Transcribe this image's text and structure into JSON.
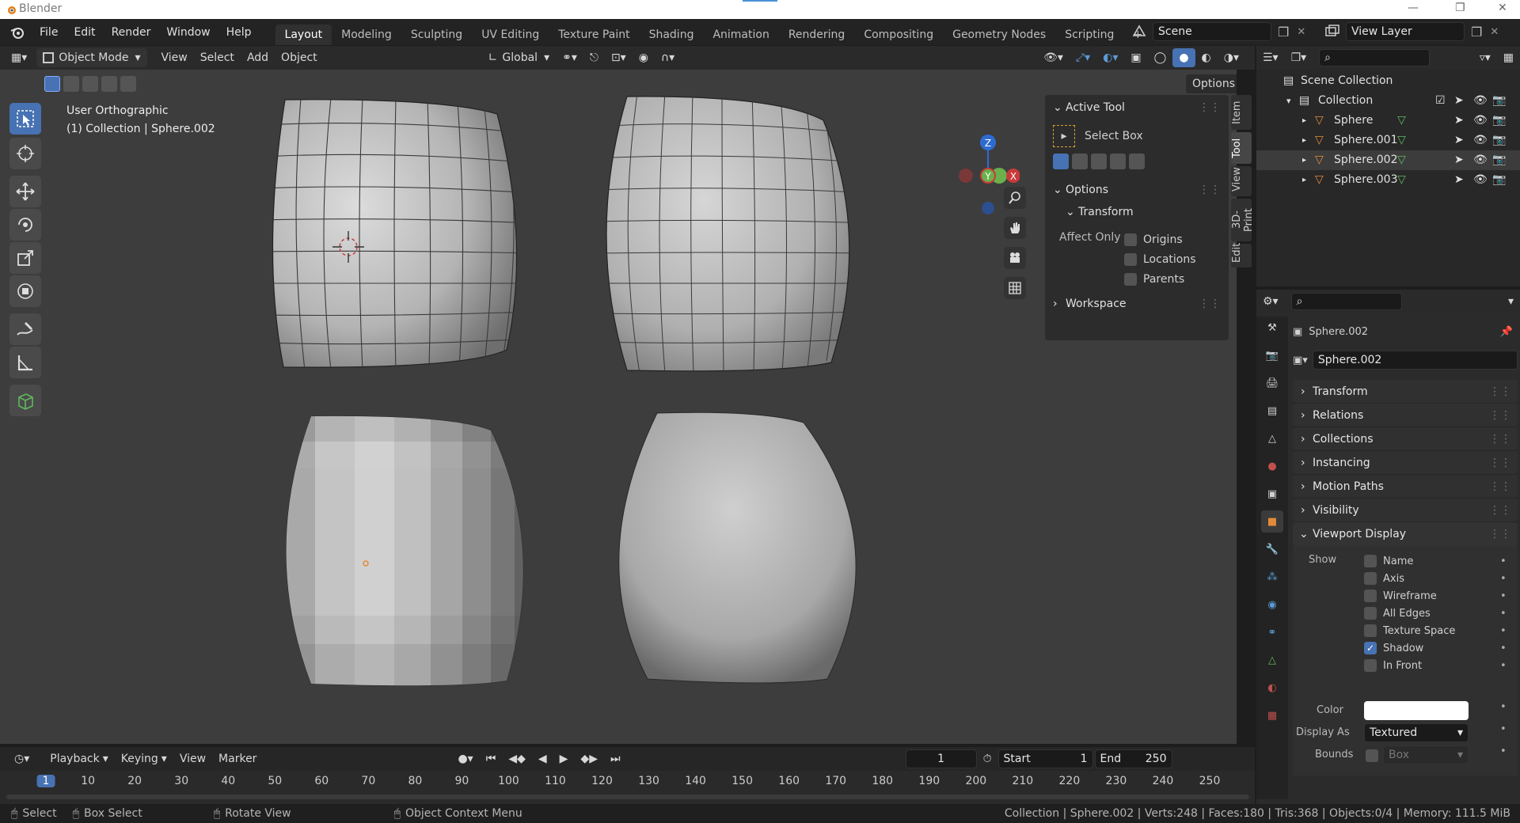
{
  "window": {
    "title": "Blender"
  },
  "menu": [
    "File",
    "Edit",
    "Render",
    "Window",
    "Help"
  ],
  "workspaces": [
    "Layout",
    "Modeling",
    "Sculpting",
    "UV Editing",
    "Texture Paint",
    "Shading",
    "Animation",
    "Rendering",
    "Compositing",
    "Geometry Nodes",
    "Scripting",
    "+"
  ],
  "active_workspace": "Layout",
  "scene": {
    "name": "Scene",
    "view_layer": "View Layer"
  },
  "viewport_header": {
    "mode": "Object Mode",
    "menus": [
      "View",
      "Select",
      "Add",
      "Object"
    ],
    "transform_orientation": "Global",
    "options_label": "Options"
  },
  "viewport_overlay": {
    "view_name": "User Orthographic",
    "collection_info": "(1) Collection | Sphere.002"
  },
  "gizmo": {
    "z": "Z",
    "y": "Y",
    "x": "X"
  },
  "npanel": {
    "active_tool_header": "Active Tool",
    "tool_name": "Select Box",
    "options_header": "Options",
    "transform_header": "Transform",
    "affect_only_label": "Affect Only",
    "affect_options": [
      "Origins",
      "Locations",
      "Parents"
    ],
    "workspace_header": "Workspace",
    "tabs": [
      "Item",
      "Tool",
      "View",
      "3D-Print",
      "Edit"
    ],
    "active_tab": "Tool"
  },
  "outliner": {
    "root": "Scene Collection",
    "collection": "Collection",
    "objects": [
      "Sphere",
      "Sphere.001",
      "Sphere.002",
      "Sphere.003"
    ],
    "selected_object": "Sphere.002"
  },
  "properties": {
    "object_name": "Sphere.002",
    "object_field": "Sphere.002",
    "sections_collapsed": [
      "Transform",
      "Relations",
      "Collections",
      "Instancing",
      "Motion Paths",
      "Visibility"
    ],
    "viewport_display": {
      "header": "Viewport Display",
      "show_label": "Show",
      "show_options": [
        {
          "label": "Name",
          "checked": false
        },
        {
          "label": "Axis",
          "checked": false
        },
        {
          "label": "Wireframe",
          "checked": false
        },
        {
          "label": "All Edges",
          "checked": false
        },
        {
          "label": "Texture Space",
          "checked": false
        },
        {
          "label": "Shadow",
          "checked": true
        },
        {
          "label": "In Front",
          "checked": false
        }
      ],
      "color_label": "Color",
      "color_value": "#ffffff",
      "display_as_label": "Display As",
      "display_as_value": "Textured",
      "bounds_label": "Bounds",
      "bounds_value": "Box"
    }
  },
  "timeline": {
    "menus": [
      "Playback",
      "Keying",
      "View",
      "Marker"
    ],
    "current_frame": "1",
    "start_label": "Start",
    "start_value": "1",
    "end_label": "End",
    "end_value": "250",
    "ruler_ticks": [
      "1",
      "10",
      "20",
      "30",
      "40",
      "50",
      "60",
      "70",
      "80",
      "90",
      "100",
      "110",
      "120",
      "130",
      "140",
      "150",
      "160",
      "170",
      "180",
      "190",
      "200",
      "210",
      "220",
      "230",
      "240",
      "250"
    ]
  },
  "statusbar": {
    "select": "Select",
    "box_select": "Box Select",
    "rotate_view": "Rotate View",
    "context_menu": "Object Context Menu",
    "stats": "Collection | Sphere.002 | Verts:248 | Faces:180 | Tris:368 | Objects:0/4 | Memory: 111.5 MiB"
  },
  "colors": {
    "accent": "#4772b3",
    "object_orange": "#e38a3a",
    "mesh_green": "#5fb85f"
  }
}
